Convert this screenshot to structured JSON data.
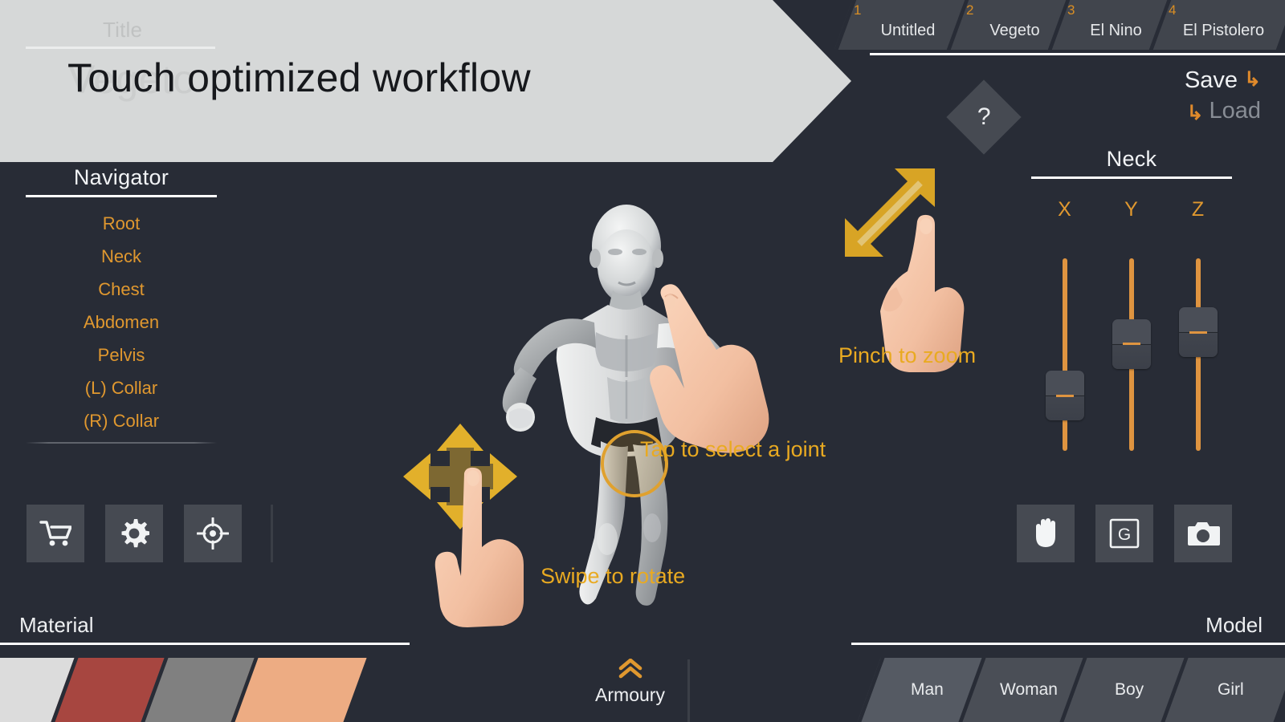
{
  "header": {
    "title_placeholder": "Title",
    "title_value": "Touch optimized workflow",
    "ghost_title": "Vegeto"
  },
  "tabs": [
    {
      "num": "1",
      "label": "Untitled"
    },
    {
      "num": "2",
      "label": "Vegeto"
    },
    {
      "num": "3",
      "label": "El Nino"
    },
    {
      "num": "4",
      "label": "El Pistolero"
    }
  ],
  "file_actions": {
    "save_label": "Save",
    "load_label": "Load",
    "save_arrow_icon": "arrow-elbow-up-icon",
    "load_arrow_icon": "arrow-elbow-down-icon"
  },
  "help": {
    "glyph": "?",
    "icon": "help-diamond-icon"
  },
  "navigator": {
    "title": "Navigator",
    "items": [
      {
        "label": "Root"
      },
      {
        "label": "Neck"
      },
      {
        "label": "Chest"
      },
      {
        "label": "Abdomen"
      },
      {
        "label": "Pelvis"
      },
      {
        "label": "(L) Collar"
      },
      {
        "label": "(R) Collar"
      }
    ]
  },
  "left_tools": [
    {
      "name": "cart-icon",
      "title": "Store"
    },
    {
      "name": "gear-icon",
      "title": "Settings"
    },
    {
      "name": "target-icon",
      "title": "Focus"
    }
  ],
  "right_tools": [
    {
      "name": "hand-icon",
      "title": "Pan"
    },
    {
      "name": "grid-g-icon",
      "title": "Grid",
      "glyph": "G"
    },
    {
      "name": "camera-icon",
      "title": "Camera"
    }
  ],
  "joint_panel": {
    "title": "Neck",
    "axes": [
      {
        "label": "X",
        "thumb_top_pct": 66
      },
      {
        "label": "Y",
        "thumb_top_pct": 39
      },
      {
        "label": "Z",
        "thumb_top_pct": 33
      }
    ]
  },
  "hints": {
    "tap": "Tap to select a joint",
    "pinch": "Pinch to zoom",
    "swipe": "Swipe to rotate"
  },
  "material": {
    "label": "Material",
    "swatches": [
      {
        "name": "white",
        "color": "#dcdcdc"
      },
      {
        "name": "red",
        "color": "#a74640"
      },
      {
        "name": "grey",
        "color": "#808080"
      },
      {
        "name": "peach",
        "color": "#edac83"
      }
    ]
  },
  "model": {
    "label": "Model",
    "options": [
      {
        "label": "Man",
        "selected": true
      },
      {
        "label": "Woman",
        "selected": false
      },
      {
        "label": "Boy",
        "selected": false
      },
      {
        "label": "Girl",
        "selected": false
      }
    ]
  },
  "armoury": {
    "label": "Armoury",
    "icon": "chevron-double-up-icon"
  },
  "colors": {
    "background": "#282c36",
    "accent_orange": "#e0982f",
    "hint_gold": "#e9aa21",
    "panel_light": "#d6d8d8",
    "button_face": "#464a52",
    "slider_track": "#df9440"
  }
}
